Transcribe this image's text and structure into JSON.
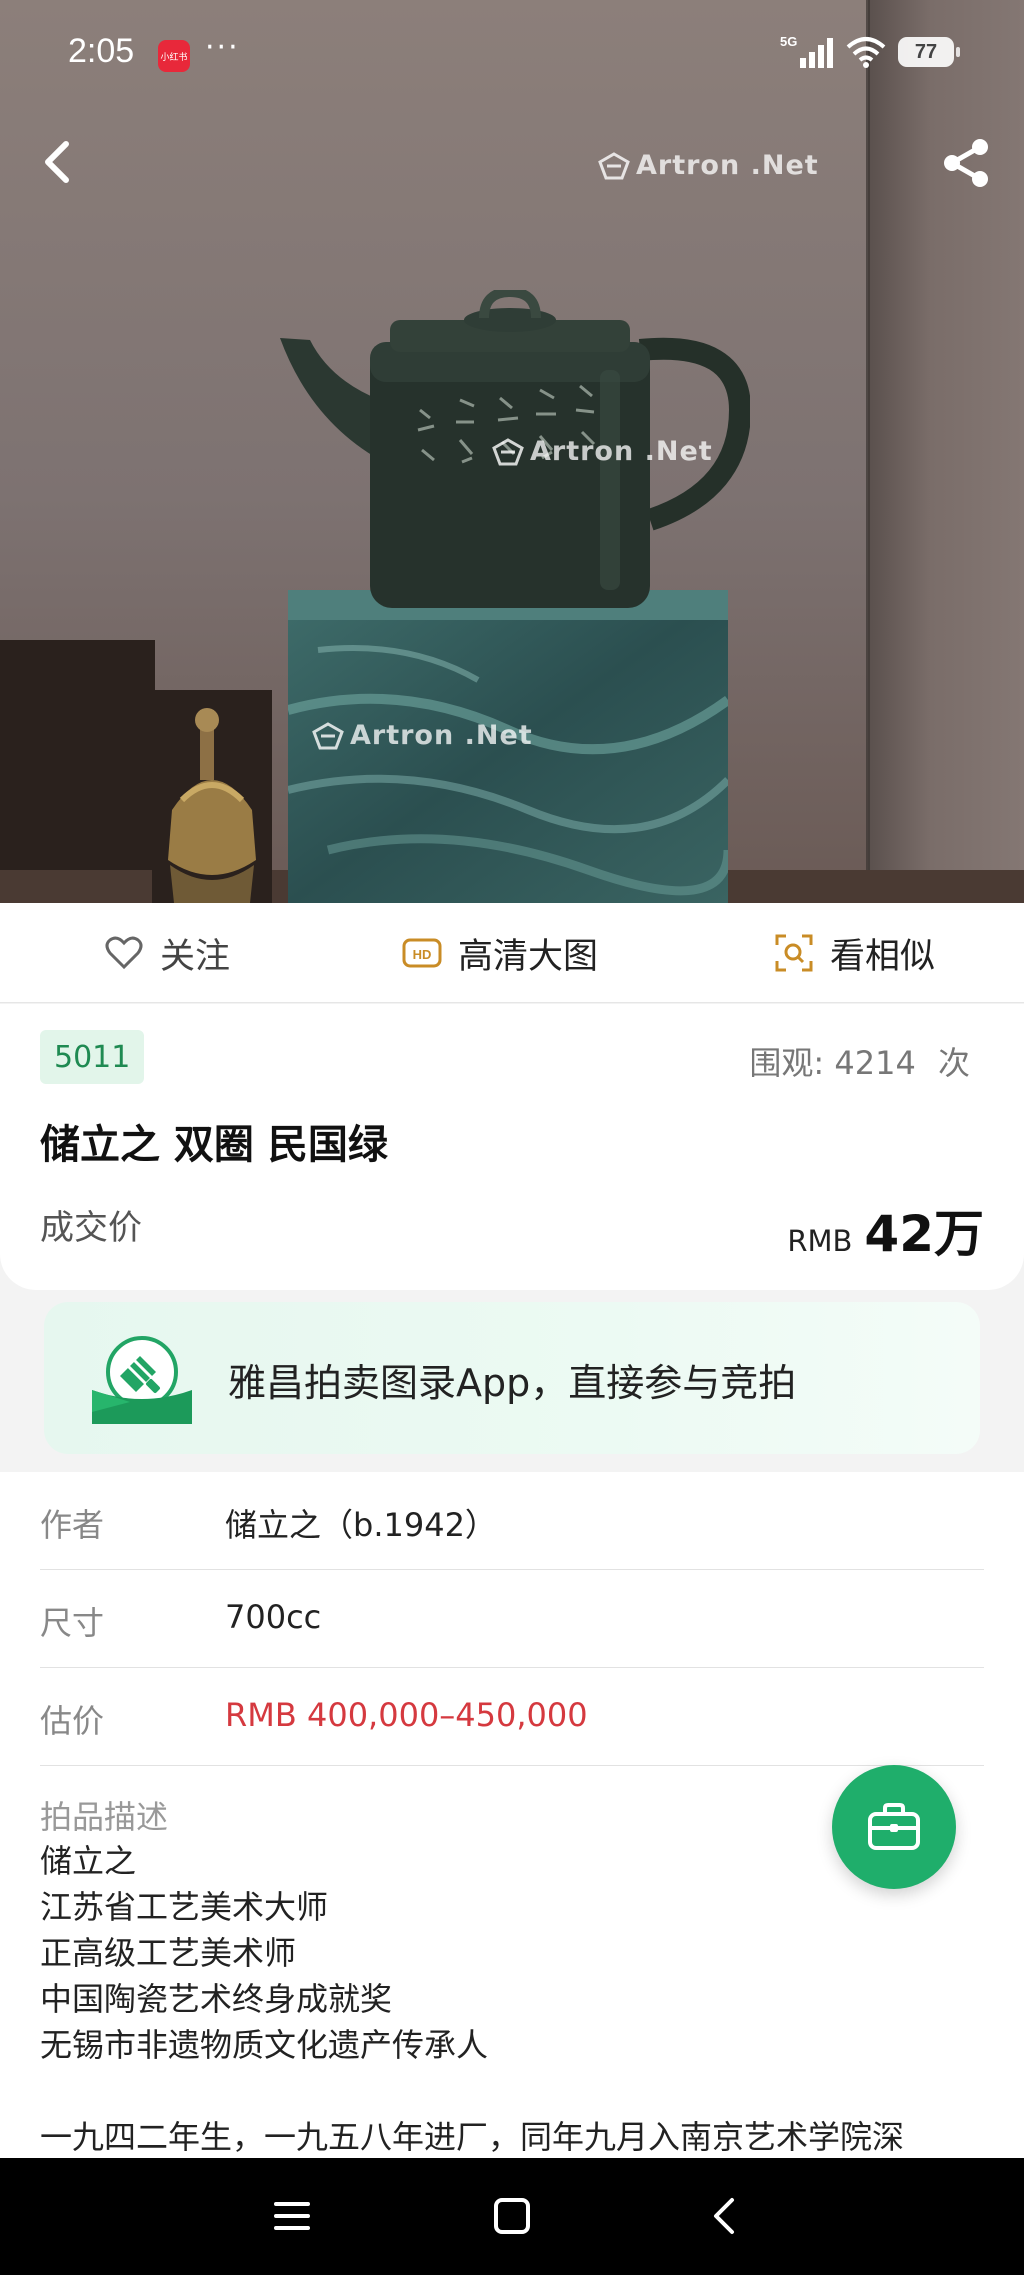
{
  "status_bar": {
    "time": "2:05",
    "app_badge": "小红书",
    "more": "···",
    "network": "5G",
    "battery": "77"
  },
  "hero": {
    "watermark": "Artron .Net"
  },
  "actions": {
    "follow": "关注",
    "hd_image": "高清大图",
    "similar": "看相似"
  },
  "lot": {
    "number": "5011",
    "views_label": "围观:",
    "views": "4214",
    "views_unit": "次",
    "title": "储立之 双圈  民国绿",
    "price_label": "成交价",
    "currency": "RMB",
    "price": "42万"
  },
  "banner": {
    "text": "雅昌拍卖图录App，直接参与竞拍"
  },
  "details": {
    "author_label": "作者",
    "author": "储立之（b.1942）",
    "size_label": "尺寸",
    "size": "700cc",
    "estimate_label": "估价",
    "estimate": "RMB  400,000–450,000",
    "description_label": "拍品描述",
    "description_lines": [
      "储立之",
      "江苏省工艺美术大师",
      "正高级工艺美术师",
      "中国陶瓷艺术终身成就奖",
      "无锡市非遗物质文化遗产传承人"
    ],
    "description_paragraph": "一九四二年生，一九五八年进厂，同年九月入南京艺术学院深"
  },
  "colors": {
    "accent_green": "#1fae6b",
    "estimate_red": "#d5393f",
    "badge_green": "#1f8a52"
  }
}
